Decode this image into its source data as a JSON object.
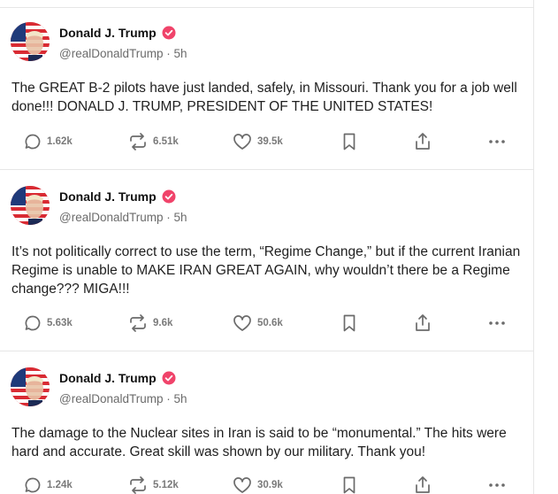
{
  "colors": {
    "verified": "#f0436a",
    "icon": "#6b6b6b",
    "divider": "#e6e6e6"
  },
  "icons": {
    "reply": "speech-bubble-icon",
    "retruth": "repost-arrows-icon",
    "like": "heart-icon",
    "bookmark": "bookmark-icon",
    "share": "share-upload-icon",
    "more": "ellipsis-icon"
  },
  "posts": [
    {
      "author": "Donald J. Trump",
      "handle": "@realDonaldTrump",
      "time": "5h",
      "text": "The GREAT B-2 pilots have just landed, safely, in Missouri. Thank you for a job well done!!! DONALD J. TRUMP, PRESIDENT OF THE UNITED STATES!",
      "replies": "1.62k",
      "retruths": "6.51k",
      "likes": "39.5k"
    },
    {
      "author": "Donald J. Trump",
      "handle": "@realDonaldTrump",
      "time": "5h",
      "text": "It’s not politically correct to use the term, “Regime Change,” but if the current Iranian Regime is unable to MAKE IRAN GREAT AGAIN, why wouldn’t there be a Regime change??? MIGA!!!",
      "replies": "5.63k",
      "retruths": "9.6k",
      "likes": "50.6k"
    },
    {
      "author": "Donald J. Trump",
      "handle": "@realDonaldTrump",
      "time": "5h",
      "text": "The damage to the Nuclear sites in Iran is said to be “monumental.” The hits were hard and accurate. Great skill was shown by our military. Thank you!",
      "replies": "1.24k",
      "retruths": "5.12k",
      "likes": "30.9k"
    }
  ]
}
